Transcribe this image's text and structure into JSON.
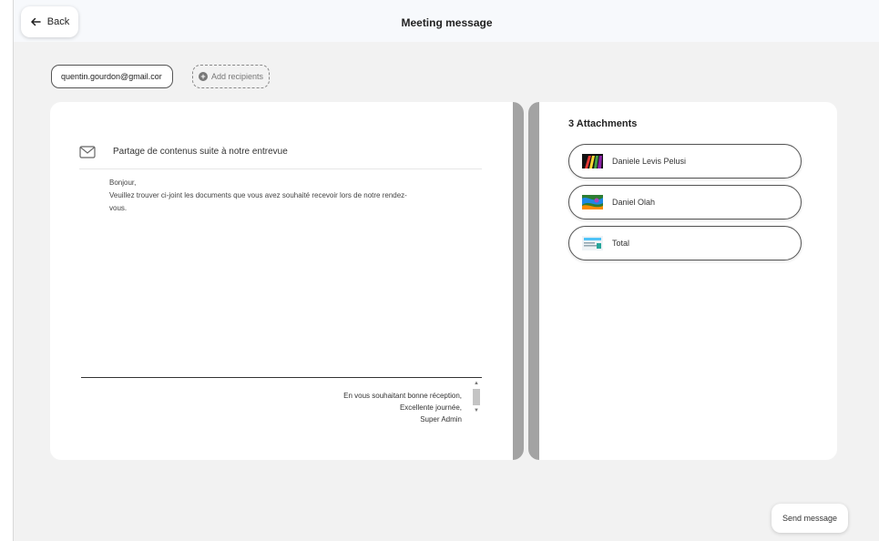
{
  "header": {
    "back_label": "Back",
    "title": "Meeting message"
  },
  "recipients": {
    "items": [
      "quentin.gourdon@gmail.cor"
    ],
    "add_label": "Add recipients"
  },
  "message": {
    "subject": "Partage de contenus suite à notre entrevue",
    "body_lines": [
      "Bonjour,",
      "Veuillez trouver ci-joint les documents que vous avez souhaité recevoir lors de notre rendez-",
      "vous."
    ],
    "signature_lines": [
      "En vous souhaitant bonne réception,",
      "Excellente journée,",
      "Super Admin"
    ]
  },
  "attachments": {
    "title": "3 Attachments",
    "items": [
      {
        "label": "Daniele Levis Pelusi",
        "thumb": "colorful-stripes-thumbnail"
      },
      {
        "label": "Daniel Olah",
        "thumb": "abstract-paint-thumbnail"
      },
      {
        "label": "Total",
        "thumb": "document-thumbnail"
      }
    ]
  },
  "footer": {
    "send_label": "Send message"
  },
  "colors": {
    "frame_bg": "#f2f2f2",
    "topbar_bg": "#f7f9fc",
    "card_edge": "#a3a3a3"
  }
}
